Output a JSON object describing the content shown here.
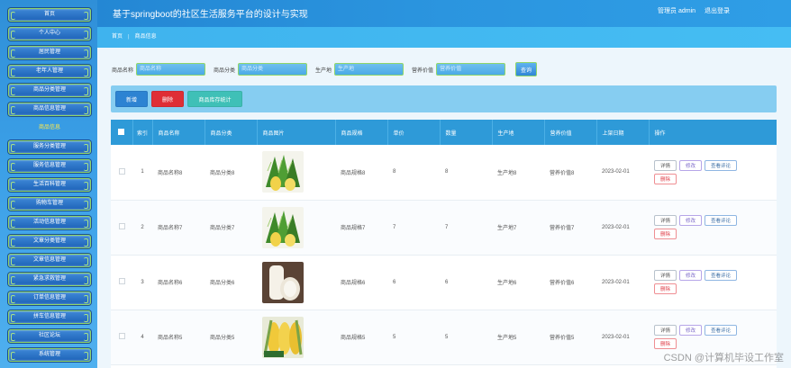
{
  "header": {
    "title": "基于springboot的社区生活服务平台的设计与实现",
    "user": "管理员 admin",
    "logout": "退出登录"
  },
  "breadcrumb": {
    "home": "首页",
    "current": "商品信息"
  },
  "sidebar": {
    "items": [
      {
        "label": "首页"
      },
      {
        "label": "个人中心"
      },
      {
        "label": "居民管理"
      },
      {
        "label": "老年人管理"
      },
      {
        "label": "商品分类管理"
      },
      {
        "label": "商品信息管理"
      },
      {
        "label": "商品信息",
        "active": true
      },
      {
        "label": "服务分类管理"
      },
      {
        "label": "服务信息管理"
      },
      {
        "label": "生活百科管理"
      },
      {
        "label": "购物车管理"
      },
      {
        "label": "活动信息管理"
      },
      {
        "label": "文章分类管理"
      },
      {
        "label": "文章信息管理"
      },
      {
        "label": "紧急求救管理"
      },
      {
        "label": "订单信息管理"
      },
      {
        "label": "拼车信息管理"
      },
      {
        "label": "社区论坛"
      },
      {
        "label": "系统管理"
      }
    ]
  },
  "search": {
    "name_label": "商品名称",
    "name_placeholder": "商品名称",
    "category_label": "商品分类",
    "category_placeholder": "商品分类",
    "origin_label": "生产地",
    "origin_placeholder": "生产地",
    "nutrition_label": "营养价值",
    "nutrition_placeholder": "营养价值",
    "button": "查询"
  },
  "actions": {
    "add": "新增",
    "delete": "删除",
    "stats": "商品库存统计"
  },
  "table": {
    "headers": [
      "索引",
      "商品名称",
      "商品分类",
      "商品图片",
      "商品规格",
      "单价",
      "数量",
      "生产地",
      "营养价值",
      "上架日期",
      "操作"
    ],
    "op_labels": {
      "detail": "详情",
      "edit": "修改",
      "review": "查看评论",
      "delete": "删除"
    },
    "rows": [
      {
        "idx": "1",
        "name": "商品名称8",
        "category": "商品分类8",
        "image": "corn",
        "spec": "商品规格8",
        "price": "8",
        "qty": "8",
        "origin": "生产地8",
        "nutrition": "营养价值8",
        "date": "2023-02-01"
      },
      {
        "idx": "2",
        "name": "商品名称7",
        "category": "商品分类7",
        "image": "corn",
        "spec": "商品规格7",
        "price": "7",
        "qty": "7",
        "origin": "生产地7",
        "nutrition": "营养价值7",
        "date": "2023-02-01"
      },
      {
        "idx": "3",
        "name": "商品名称6",
        "category": "商品分类6",
        "image": "radish",
        "spec": "商品规格6",
        "price": "6",
        "qty": "6",
        "origin": "生产地6",
        "nutrition": "营养价值6",
        "date": "2023-02-01"
      },
      {
        "idx": "4",
        "name": "商品名称5",
        "category": "商品分类5",
        "image": "corn-yellow",
        "spec": "商品规格5",
        "price": "5",
        "qty": "5",
        "origin": "生产地5",
        "nutrition": "营养价值5",
        "date": "2023-02-01"
      }
    ]
  },
  "watermark": "CSDN @计算机毕设工作室",
  "colors": {
    "sidebar": "#3a9ee6",
    "header": "#2b95df",
    "table_head": "#2e9ad8",
    "add": "#2d83d2",
    "delete": "#df2e36",
    "stats": "#3fc0b7"
  }
}
